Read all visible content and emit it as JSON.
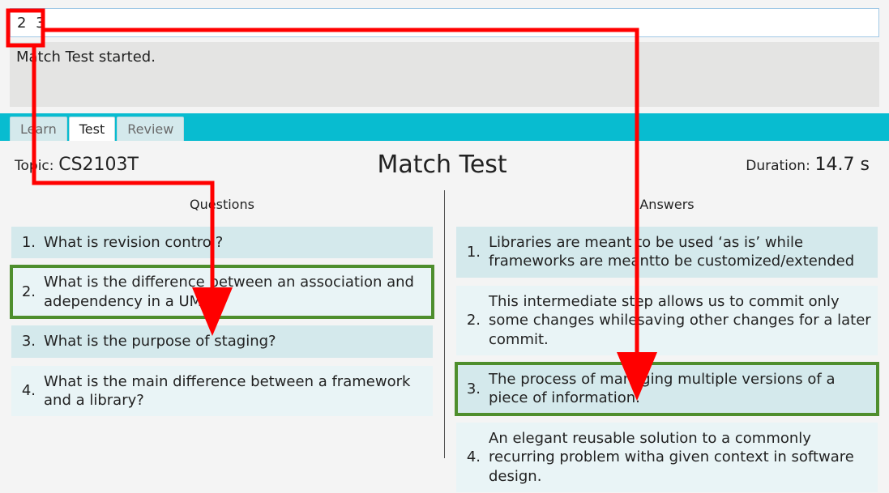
{
  "input": {
    "value": "2 3"
  },
  "status": {
    "text": "Match Test started."
  },
  "tabs": [
    {
      "label": "Learn",
      "active": false
    },
    {
      "label": "Test",
      "active": true
    },
    {
      "label": "Review",
      "active": false
    }
  ],
  "header": {
    "topic_label": "Topic:",
    "topic_value": "CS2103T",
    "title": "Match Test",
    "duration_label": "Duration:",
    "duration_value": "14.7 s"
  },
  "columns": {
    "questions_header": "Questions",
    "answers_header": "Answers",
    "questions": [
      {
        "n": "1.",
        "text": "What is revision control?"
      },
      {
        "n": "2.",
        "text": "What is the difference between an association and adependency in a UML?"
      },
      {
        "n": "3.",
        "text": "What is the purpose of staging?"
      },
      {
        "n": "4.",
        "text": "What is the main difference between a framework and a library?"
      }
    ],
    "answers": [
      {
        "n": "1.",
        "text": "Libraries are meant to be used ‘as is’ while frameworks are meantto be customized/extended"
      },
      {
        "n": "2.",
        "text": "This intermediate step allows us to commit only some changes whilesaving other changes for a later commit."
      },
      {
        "n": "3.",
        "text": "The process of managing multiple versions of a piece of information."
      },
      {
        "n": "4.",
        "text": "An elegant reusable solution to a commonly recurring problem witha given context in software design."
      }
    ]
  },
  "annotations": {
    "red_boxes": [
      {
        "desc": "input-highlight"
      }
    ],
    "green_boxes": [
      {
        "target": "question-2"
      },
      {
        "target": "answer-3"
      }
    ],
    "arrows": [
      {
        "from": "input",
        "to": "question-2"
      },
      {
        "from": "input",
        "to": "answer-3"
      }
    ]
  }
}
